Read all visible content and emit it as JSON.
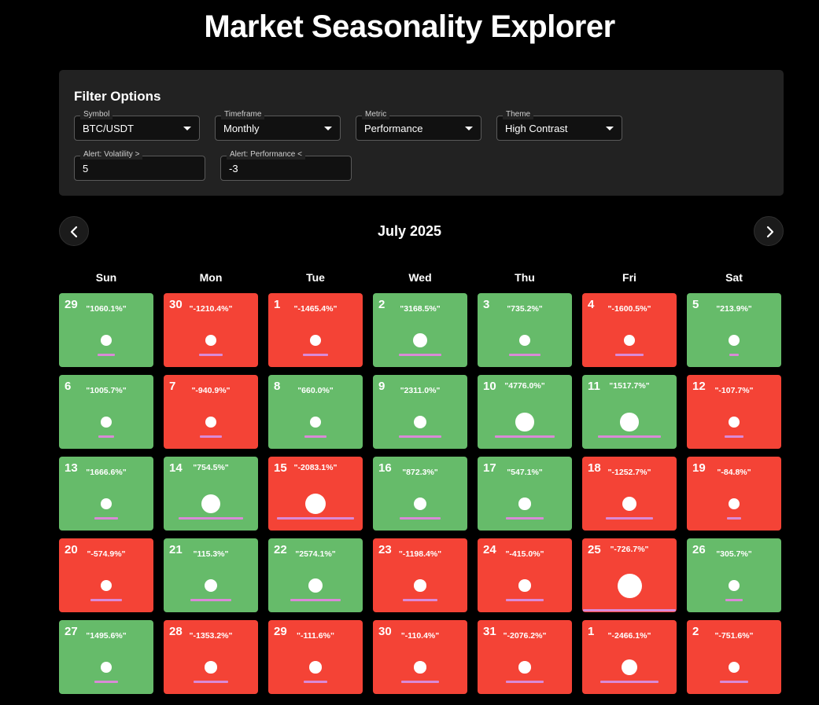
{
  "title": "Market Seasonality Explorer",
  "filters": {
    "heading": "Filter Options",
    "symbol": {
      "label": "Symbol",
      "value": "BTC/USDT"
    },
    "timeframe": {
      "label": "Timeframe",
      "value": "Monthly"
    },
    "metric": {
      "label": "Metric",
      "value": "Performance"
    },
    "theme": {
      "label": "Theme",
      "value": "High Contrast"
    },
    "alert_volatility": {
      "label": "Alert: Volatility >",
      "value": "5"
    },
    "alert_performance": {
      "label": "Alert: Performance <",
      "value": "-3"
    }
  },
  "calendar": {
    "month": "July 2025",
    "prev_icon": "chevron-left-icon",
    "next_icon": "chevron-right-icon",
    "weekdays": [
      "Sun",
      "Mon",
      "Tue",
      "Wed",
      "Thu",
      "Fri",
      "Sat"
    ],
    "colors": {
      "positive": "#66bb6a",
      "negative": "#f44336",
      "volatility_bar": "#d98ad7"
    },
    "days": [
      {
        "day": "29",
        "perf": "\"1060.1%\"",
        "trend": "up",
        "vol": 0.22,
        "bar": 0.18
      },
      {
        "day": "30",
        "perf": "\"-1210.4%\"",
        "trend": "down",
        "vol": 0.22,
        "bar": 0.26
      },
      {
        "day": "1",
        "perf": "\"-1465.4%\"",
        "trend": "down",
        "vol": 0.22,
        "bar": 0.27
      },
      {
        "day": "2",
        "perf": "\"3168.5%\"",
        "trend": "up",
        "vol": 0.45,
        "bar": 0.45
      },
      {
        "day": "3",
        "perf": "\"735.2%\"",
        "trend": "up",
        "vol": 0.22,
        "bar": 0.34
      },
      {
        "day": "4",
        "perf": "\"-1600.5%\"",
        "trend": "down",
        "vol": 0.22,
        "bar": 0.31
      },
      {
        "day": "5",
        "perf": "\"213.9%\"",
        "trend": "up",
        "vol": 0.22,
        "bar": 0.1
      },
      {
        "day": "6",
        "perf": "\"1005.7%\"",
        "trend": "up",
        "vol": 0.22,
        "bar": 0.17
      },
      {
        "day": "7",
        "perf": "\"-940.9%\"",
        "trend": "down",
        "vol": 0.22,
        "bar": 0.24
      },
      {
        "day": "8",
        "perf": "\"660.0%\"",
        "trend": "up",
        "vol": 0.22,
        "bar": 0.24
      },
      {
        "day": "9",
        "perf": "\"2311.0%\"",
        "trend": "up",
        "vol": 0.35,
        "bar": 0.45
      },
      {
        "day": "10",
        "perf": "\"4776.0%\"",
        "trend": "up",
        "vol": 0.65,
        "bar": 0.64
      },
      {
        "day": "11",
        "perf": "\"1517.7%\"",
        "trend": "up",
        "vol": 0.65,
        "bar": 0.67
      },
      {
        "day": "12",
        "perf": "\"-107.7%\"",
        "trend": "down",
        "vol": 0.22,
        "bar": 0.21
      },
      {
        "day": "13",
        "perf": "\"1666.6%\"",
        "trend": "up",
        "vol": 0.22,
        "bar": 0.25
      },
      {
        "day": "14",
        "perf": "\"754.5%\"",
        "trend": "up",
        "vol": 0.7,
        "bar": 0.7
      },
      {
        "day": "15",
        "perf": "\"-2083.1%\"",
        "trend": "down",
        "vol": 0.8,
        "bar": 0.83
      },
      {
        "day": "16",
        "perf": "\"872.3%\"",
        "trend": "up",
        "vol": 0.35,
        "bar": 0.44
      },
      {
        "day": "17",
        "perf": "\"547.1%\"",
        "trend": "up",
        "vol": 0.3,
        "bar": 0.4
      },
      {
        "day": "18",
        "perf": "\"-1252.7%\"",
        "trend": "down",
        "vol": 0.45,
        "bar": 0.51
      },
      {
        "day": "19",
        "perf": "\"-84.8%\"",
        "trend": "down",
        "vol": 0.22,
        "bar": 0.15
      },
      {
        "day": "20",
        "perf": "\"-574.9%\"",
        "trend": "down",
        "vol": 0.25,
        "bar": 0.34
      },
      {
        "day": "21",
        "perf": "\"115.3%\"",
        "trend": "up",
        "vol": 0.35,
        "bar": 0.44
      },
      {
        "day": "22",
        "perf": "\"2574.1%\"",
        "trend": "up",
        "vol": 0.45,
        "bar": 0.54
      },
      {
        "day": "23",
        "perf": "\"-1198.4%\"",
        "trend": "down",
        "vol": 0.3,
        "bar": 0.38
      },
      {
        "day": "24",
        "perf": "\"-415.0%\"",
        "trend": "down",
        "vol": 0.3,
        "bar": 0.41
      },
      {
        "day": "25",
        "perf": "\"-726.7%\"",
        "trend": "down",
        "vol": 1.0,
        "bar": 1.0
      },
      {
        "day": "26",
        "perf": "\"305.7%\"",
        "trend": "up",
        "vol": 0.22,
        "bar": 0.18
      },
      {
        "day": "27",
        "perf": "\"1495.6%\"",
        "trend": "up",
        "vol": 0.22,
        "bar": 0.25
      },
      {
        "day": "28",
        "perf": "\"-1353.2%\"",
        "trend": "down",
        "vol": 0.3,
        "bar": 0.37
      },
      {
        "day": "29",
        "perf": "\"-111.6%\"",
        "trend": "down",
        "vol": 0.3,
        "bar": 0.26
      },
      {
        "day": "30",
        "perf": "\"-110.4%\"",
        "trend": "down",
        "vol": 0.3,
        "bar": 0.41
      },
      {
        "day": "31",
        "perf": "\"-2076.2%\"",
        "trend": "down",
        "vol": 0.3,
        "bar": 0.41
      },
      {
        "day": "1",
        "perf": "\"-2466.1%\"",
        "trend": "down",
        "vol": 0.5,
        "bar": 0.62
      },
      {
        "day": "2",
        "perf": "\"-751.6%\"",
        "trend": "down",
        "vol": 0.25,
        "bar": 0.3
      }
    ]
  }
}
